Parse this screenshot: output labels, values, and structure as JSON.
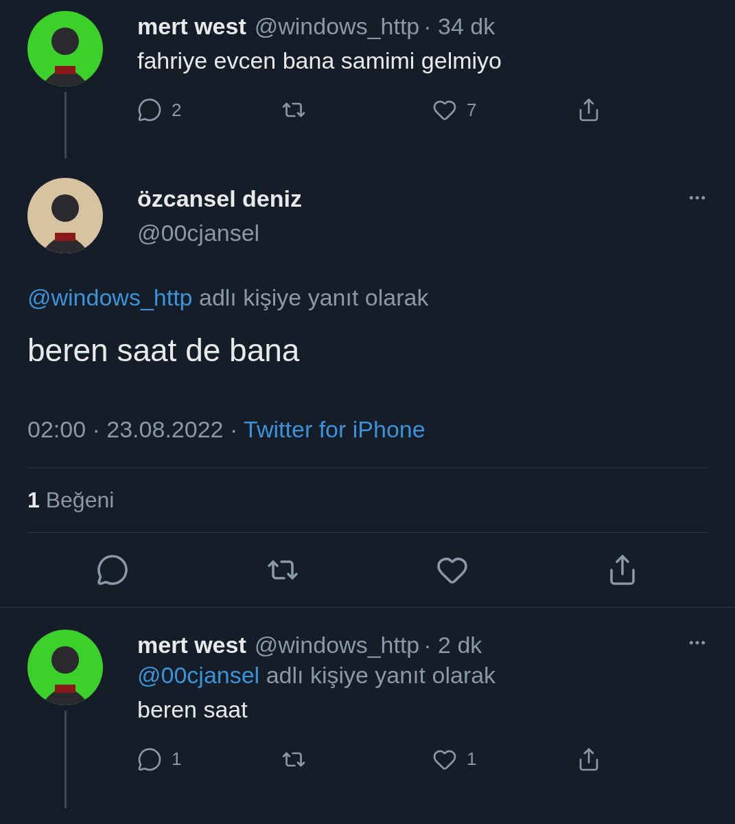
{
  "thread": [
    {
      "kind": "compact",
      "avatar": {
        "color": "#3bd12a"
      },
      "name": "mert west",
      "handle": "@windows_http",
      "time": "· 34 dk",
      "menu": false,
      "connected": true,
      "text": "fahriye evcen bana samimi gelmiyo",
      "actions": [
        {
          "kind": "reply",
          "count": "2"
        },
        {
          "kind": "retweet"
        },
        {
          "kind": "like",
          "count": "7"
        },
        {
          "kind": "share"
        }
      ]
    },
    {
      "kind": "focused",
      "avatar": {
        "color": "#d8c3a0"
      },
      "name": "özcansel deniz",
      "handle": "@00cjansel",
      "menu": true,
      "reply_to": {
        "handle": "@windows_http",
        "text": "adlı kişiye yanıt olarak"
      },
      "text": "beren saat de bana",
      "timestamp": "02:00 · 23.08.2022 ·",
      "source": "Twitter for iPhone",
      "likes": {
        "count": "1",
        "label": "Beğeni"
      },
      "actions": [
        {
          "kind": "reply"
        },
        {
          "kind": "retweet"
        },
        {
          "kind": "like"
        },
        {
          "kind": "share"
        }
      ]
    },
    {
      "kind": "compact",
      "avatar": {
        "color": "#3bd12a"
      },
      "name": "mert west",
      "handle": "@windows_http",
      "time": "· 2 dk",
      "menu": true,
      "connected": true,
      "reply_to": {
        "handle": "@00cjansel",
        "text": "adlı kişiye yanıt olarak"
      },
      "text": "beren saat",
      "actions": [
        {
          "kind": "reply",
          "count": "1"
        },
        {
          "kind": "retweet"
        },
        {
          "kind": "like",
          "count": "1"
        },
        {
          "kind": "share"
        }
      ]
    }
  ]
}
